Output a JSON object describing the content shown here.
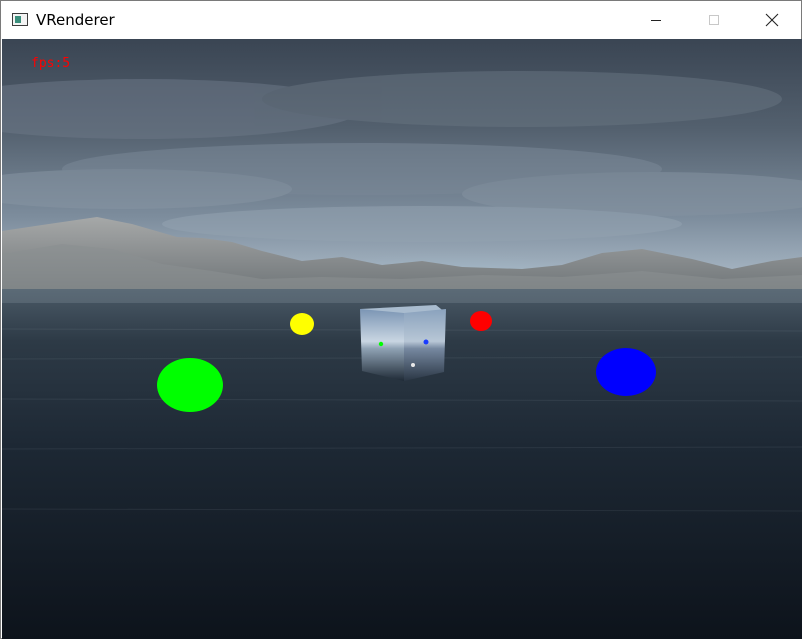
{
  "window": {
    "title": "VRenderer",
    "app_icon": "window-app-icon",
    "controls": {
      "minimize_icon": "minimize-icon",
      "maximize_icon": "maximize-icon",
      "close_icon": "close-icon"
    }
  },
  "viewport": {
    "fps_text": "fps:5",
    "colors": {
      "fps_text": "#ff0000",
      "sphere_yellow": "#ffff00",
      "sphere_red": "#ff0000",
      "sphere_green": "#00ff00",
      "sphere_blue": "#0000ff",
      "sky_top": "#3b4756",
      "sky_horizon": "#aebdcb",
      "water": "#1a2430"
    },
    "objects": [
      "reflective-cube",
      "yellow-sphere",
      "red-sphere",
      "green-sphere",
      "blue-sphere"
    ]
  }
}
